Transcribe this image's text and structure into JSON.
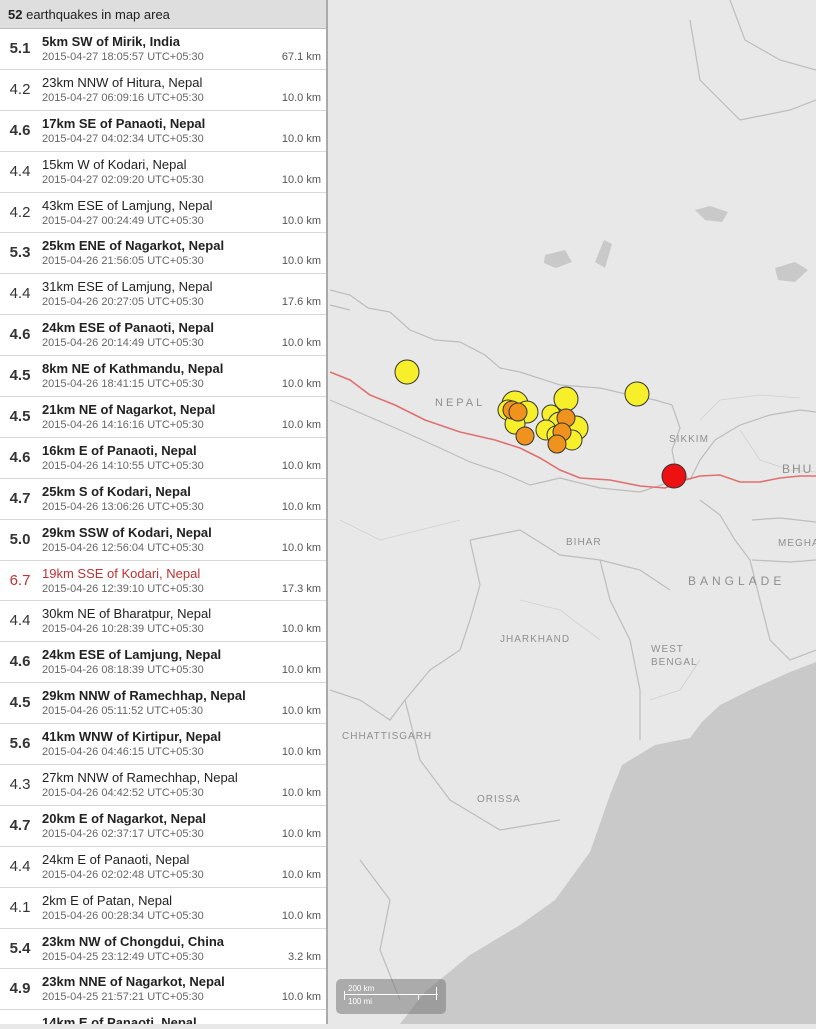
{
  "list": {
    "count": "52",
    "header_text": "earthquakes in map area",
    "items": [
      {
        "mag": "5.1",
        "place": "5km SW of Mirik, India",
        "time": "2015-04-27 18:05:57 UTC+05:30",
        "depth": "67.1 km"
      },
      {
        "mag": "4.2",
        "place": "23km NNW of Hitura, Nepal",
        "time": "2015-04-27 06:09:16 UTC+05:30",
        "depth": "10.0 km"
      },
      {
        "mag": "4.6",
        "place": "17km SE of Panaoti, Nepal",
        "time": "2015-04-27 04:02:34 UTC+05:30",
        "depth": "10.0 km"
      },
      {
        "mag": "4.4",
        "place": "15km W of Kodari, Nepal",
        "time": "2015-04-27 02:09:20 UTC+05:30",
        "depth": "10.0 km"
      },
      {
        "mag": "4.2",
        "place": "43km ESE of Lamjung, Nepal",
        "time": "2015-04-27 00:24:49 UTC+05:30",
        "depth": "10.0 km"
      },
      {
        "mag": "5.3",
        "place": "25km ENE of Nagarkot, Nepal",
        "time": "2015-04-26 21:56:05 UTC+05:30",
        "depth": "10.0 km"
      },
      {
        "mag": "4.4",
        "place": "31km ESE of Lamjung, Nepal",
        "time": "2015-04-26 20:27:05 UTC+05:30",
        "depth": "17.6 km"
      },
      {
        "mag": "4.6",
        "place": "24km ESE of Panaoti, Nepal",
        "time": "2015-04-26 20:14:49 UTC+05:30",
        "depth": "10.0 km"
      },
      {
        "mag": "4.5",
        "place": "8km NE of Kathmandu, Nepal",
        "time": "2015-04-26 18:41:15 UTC+05:30",
        "depth": "10.0 km"
      },
      {
        "mag": "4.5",
        "place": "21km NE of Nagarkot, Nepal",
        "time": "2015-04-26 14:16:16 UTC+05:30",
        "depth": "10.0 km"
      },
      {
        "mag": "4.6",
        "place": "16km E of Panaoti, Nepal",
        "time": "2015-04-26 14:10:55 UTC+05:30",
        "depth": "10.0 km"
      },
      {
        "mag": "4.7",
        "place": "25km S of Kodari, Nepal",
        "time": "2015-04-26 13:06:26 UTC+05:30",
        "depth": "10.0 km"
      },
      {
        "mag": "5.0",
        "place": "29km SSW of Kodari, Nepal",
        "time": "2015-04-26 12:56:04 UTC+05:30",
        "depth": "10.0 km"
      },
      {
        "mag": "6.7",
        "place": "19km SSE of Kodari, Nepal",
        "time": "2015-04-26 12:39:10 UTC+05:30",
        "depth": "17.3 km"
      },
      {
        "mag": "4.4",
        "place": "30km NE of Bharatpur, Nepal",
        "time": "2015-04-26 10:28:39 UTC+05:30",
        "depth": "10.0 km"
      },
      {
        "mag": "4.6",
        "place": "24km ESE of Lamjung, Nepal",
        "time": "2015-04-26 08:18:39 UTC+05:30",
        "depth": "10.0 km"
      },
      {
        "mag": "4.5",
        "place": "29km NNW of Ramechhap, Nepal",
        "time": "2015-04-26 05:11:52 UTC+05:30",
        "depth": "10.0 km"
      },
      {
        "mag": "5.6",
        "place": "41km WNW of Kirtipur, Nepal",
        "time": "2015-04-26 04:46:15 UTC+05:30",
        "depth": "10.0 km"
      },
      {
        "mag": "4.3",
        "place": "27km NNW of Ramechhap, Nepal",
        "time": "2015-04-26 04:42:52 UTC+05:30",
        "depth": "10.0 km"
      },
      {
        "mag": "4.7",
        "place": "20km E of Nagarkot, Nepal",
        "time": "2015-04-26 02:37:17 UTC+05:30",
        "depth": "10.0 km"
      },
      {
        "mag": "4.4",
        "place": "24km E of Panaoti, Nepal",
        "time": "2015-04-26 02:02:48 UTC+05:30",
        "depth": "10.0 km"
      },
      {
        "mag": "4.1",
        "place": "2km E of Patan, Nepal",
        "time": "2015-04-26 00:28:34 UTC+05:30",
        "depth": "10.0 km"
      },
      {
        "mag": "5.4",
        "place": "23km NW of Chongdui, China",
        "time": "2015-04-25 23:12:49 UTC+05:30",
        "depth": "3.2 km"
      },
      {
        "mag": "4.9",
        "place": "23km NNE of Nagarkot, Nepal",
        "time": "2015-04-25 21:57:21 UTC+05:30",
        "depth": "10.0 km"
      },
      {
        "mag": "",
        "place": "14km E of Panaoti, Nepal",
        "time": "",
        "depth": ""
      }
    ]
  },
  "map": {
    "labels": {
      "nepal": "NEPAL",
      "sikkim": "SIKKIM",
      "bhutan": "BHU",
      "bihar": "BIHAR",
      "megha": "MEGHA",
      "bangladesh": "BANGLADE",
      "jharkhand": "JHARKHAND",
      "west_bengal_1": "WEST",
      "west_bengal_2": "BENGAL",
      "chhattisgarh": "CHHATTISGARH",
      "orissa": "ORISSA"
    },
    "scale": {
      "km": "200 km",
      "mi": "100 mi"
    },
    "colors": {
      "yellow": "#f7ef2a",
      "orange": "#f0921e",
      "red": "#ee1111",
      "plate_boundary": "#e07070",
      "water": "#c9c9c9",
      "land": "#e8e8e8"
    }
  }
}
